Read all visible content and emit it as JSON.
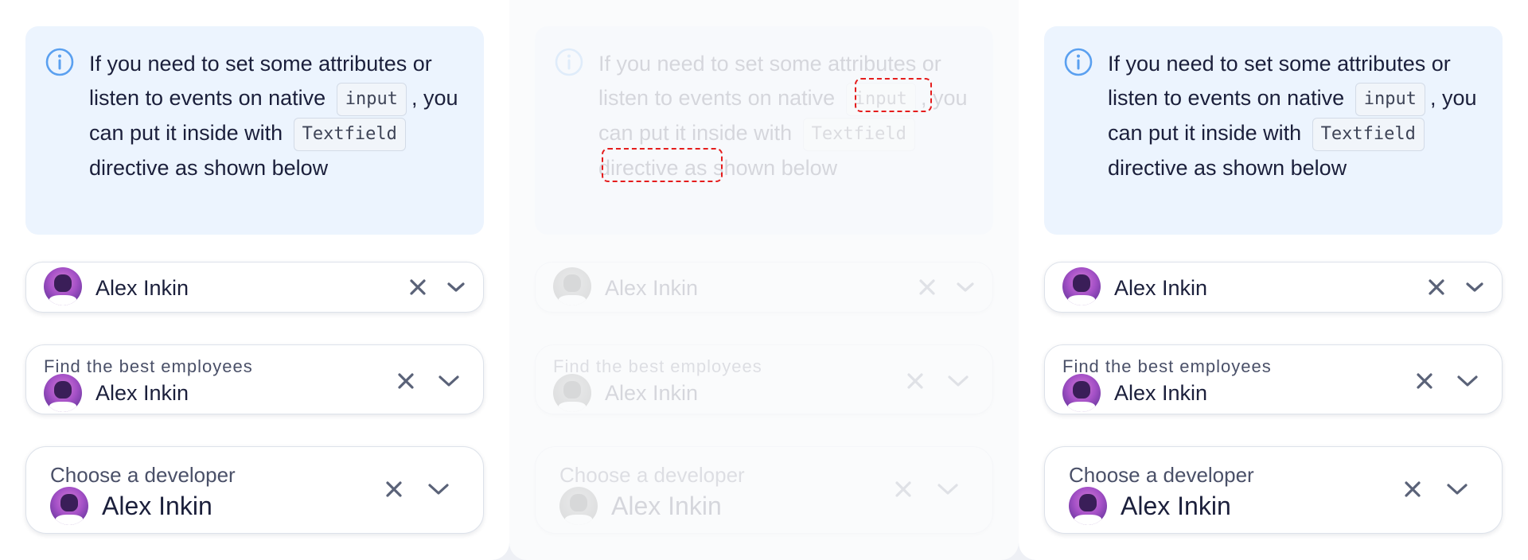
{
  "notice": {
    "line1": "If you need to set some attributes or listen to events on native",
    "code_input": "input",
    "after_input": ", you can put it inside with",
    "code_textfield": "Textfield",
    "line_end": "directive as shown below"
  },
  "fields": {
    "basic": {
      "value": "Alex Inkin"
    },
    "labeled_small": {
      "label": "Find the best employees",
      "value": "Alex Inkin"
    },
    "labeled_large": {
      "label": "Choose a developer",
      "value": "Alex Inkin"
    }
  },
  "icons": {
    "info": "info-icon",
    "clear": "close-icon",
    "dropdown": "chevron-down-icon"
  },
  "colors": {
    "notice_bg": "#ecf4fe",
    "info_icon": "#5aa0f0",
    "error_outline": "#e51c1c",
    "icon_gray": "#5a6278"
  }
}
